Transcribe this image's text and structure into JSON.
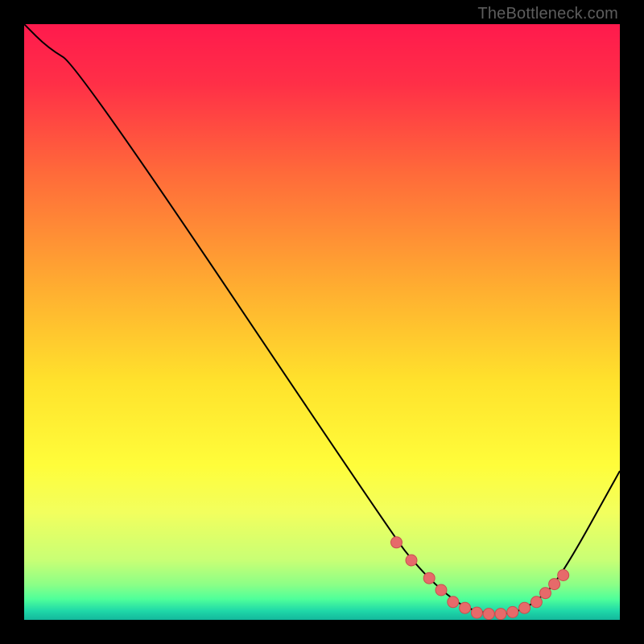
{
  "attribution": "TheBottleneck.com",
  "colors": {
    "frame": "#000000",
    "curve": "#000000",
    "dot_fill": "#e66a6a",
    "dot_stroke": "#c94f4f",
    "gradient_stops": [
      {
        "offset": 0,
        "color": "#ff1a4d"
      },
      {
        "offset": 0.1,
        "color": "#ff2f47"
      },
      {
        "offset": 0.25,
        "color": "#ff6a3a"
      },
      {
        "offset": 0.45,
        "color": "#ffb030"
      },
      {
        "offset": 0.6,
        "color": "#ffe22c"
      },
      {
        "offset": 0.74,
        "color": "#fffd3a"
      },
      {
        "offset": 0.82,
        "color": "#f2ff5e"
      },
      {
        "offset": 0.9,
        "color": "#c8ff75"
      },
      {
        "offset": 0.94,
        "color": "#8dff86"
      },
      {
        "offset": 0.965,
        "color": "#4fff9a"
      },
      {
        "offset": 0.985,
        "color": "#1fd8a8"
      },
      {
        "offset": 1.0,
        "color": "#14b79d"
      }
    ]
  },
  "chart_data": {
    "type": "line",
    "title": "",
    "xlabel": "",
    "ylabel": "",
    "xlim": [
      0,
      100
    ],
    "ylim": [
      0,
      100
    ],
    "series": [
      {
        "name": "bottleneck-curve",
        "x": [
          0,
          4,
          9,
          62,
          66,
          70,
          74,
          78,
          82,
          86,
          90,
          100
        ],
        "y": [
          100,
          96,
          93,
          14,
          9,
          5,
          2,
          1,
          1,
          3,
          7,
          25
        ]
      }
    ],
    "highlight_points": {
      "name": "optimal-range",
      "x": [
        62.5,
        65,
        68,
        70,
        72,
        74,
        76,
        78,
        80,
        82,
        84,
        86,
        87.5,
        89,
        90.5
      ],
      "y": [
        13,
        10,
        7,
        5,
        3,
        2,
        1.2,
        1,
        1,
        1.3,
        2,
        3,
        4.5,
        6,
        7.5
      ]
    }
  }
}
